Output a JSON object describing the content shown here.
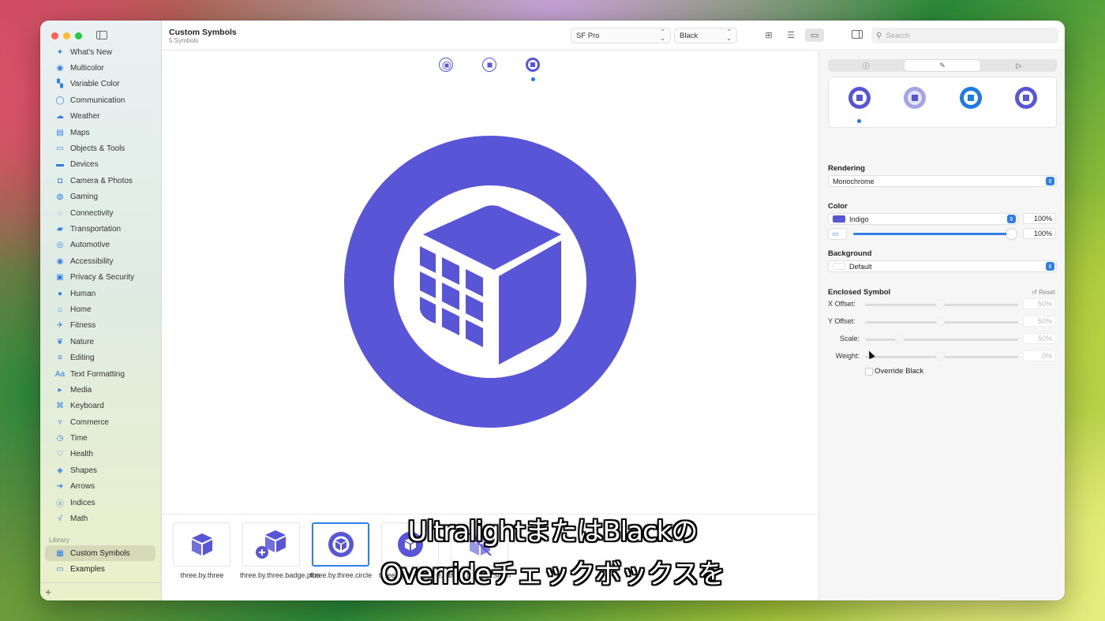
{
  "window": {
    "title": "Custom Symbols",
    "subtitle": "5 Symbols"
  },
  "toolbar": {
    "font_popup": "SF Pro",
    "weight_popup": "Black",
    "search_placeholder": "Search"
  },
  "sidebar": {
    "categories": [
      {
        "label": "What's New",
        "icon": "sparkle-icon"
      },
      {
        "label": "Multicolor",
        "icon": "paintpalette-icon"
      },
      {
        "label": "Variable Color",
        "icon": "variable-color-icon"
      },
      {
        "label": "Communication",
        "icon": "message-icon"
      },
      {
        "label": "Weather",
        "icon": "cloud-sun-icon"
      },
      {
        "label": "Maps",
        "icon": "map-icon"
      },
      {
        "label": "Objects & Tools",
        "icon": "folder-icon"
      },
      {
        "label": "Devices",
        "icon": "display-icon"
      },
      {
        "label": "Camera & Photos",
        "icon": "camera-icon"
      },
      {
        "label": "Gaming",
        "icon": "gamecontroller-icon"
      },
      {
        "label": "Connectivity",
        "icon": "antenna-icon"
      },
      {
        "label": "Transportation",
        "icon": "car-icon"
      },
      {
        "label": "Automotive",
        "icon": "steering-wheel-icon"
      },
      {
        "label": "Accessibility",
        "icon": "accessibility-icon"
      },
      {
        "label": "Privacy & Security",
        "icon": "lock-icon"
      },
      {
        "label": "Human",
        "icon": "person-icon"
      },
      {
        "label": "Home",
        "icon": "house-icon"
      },
      {
        "label": "Fitness",
        "icon": "figure-run-icon"
      },
      {
        "label": "Nature",
        "icon": "leaf-icon"
      },
      {
        "label": "Editing",
        "icon": "slider-icon"
      },
      {
        "label": "Text Formatting",
        "icon": "textformat-icon"
      },
      {
        "label": "Media",
        "icon": "playpause-icon"
      },
      {
        "label": "Keyboard",
        "icon": "command-icon"
      },
      {
        "label": "Commerce",
        "icon": "cart-icon"
      },
      {
        "label": "Time",
        "icon": "clock-icon"
      },
      {
        "label": "Health",
        "icon": "heart-icon"
      },
      {
        "label": "Shapes",
        "icon": "shapes-icon"
      },
      {
        "label": "Arrows",
        "icon": "arrow-icon"
      },
      {
        "label": "Indices",
        "icon": "a-circle-icon"
      },
      {
        "label": "Math",
        "icon": "sqrt-icon"
      }
    ],
    "library_header": "Library",
    "library_items": [
      {
        "label": "Custom Symbols",
        "selected": true
      },
      {
        "label": "Examples",
        "selected": false
      }
    ],
    "add_label": "+"
  },
  "thumbnails": [
    {
      "label": "three.by.three",
      "selected": false
    },
    {
      "label": "three.by.three.badge.plus",
      "selected": false
    },
    {
      "label": "three.by.three.circle",
      "selected": true
    },
    {
      "label": "three.by.three.circle.fill",
      "selected": false
    },
    {
      "label": "three.by.three.slash",
      "selected": false
    }
  ],
  "inspector": {
    "rendering_label": "Rendering",
    "rendering_value": "Monochrome",
    "color_label": "Color",
    "color_value": "Indigo",
    "color_hex": "#5856d6",
    "color_opacity": "100%",
    "slider_value": "100%",
    "background_label": "Background",
    "background_value": "Default",
    "enclosed_label": "Enclosed Symbol",
    "reset_label": "Reset",
    "x_offset_label": "X Offset:",
    "x_offset_value": "50%",
    "y_offset_label": "Y Offset:",
    "y_offset_value": "50%",
    "scale_label": "Scale:",
    "scale_value": "50%",
    "weight_label": "Weight:",
    "weight_value": "0%",
    "override_label": "Override Black"
  },
  "subtitles": {
    "line1": "UltralightまたはBlackの",
    "line2": "Overrideチェックボックスを"
  },
  "colors": {
    "accent": "#1f7ae8",
    "indigo": "#5856d6"
  }
}
